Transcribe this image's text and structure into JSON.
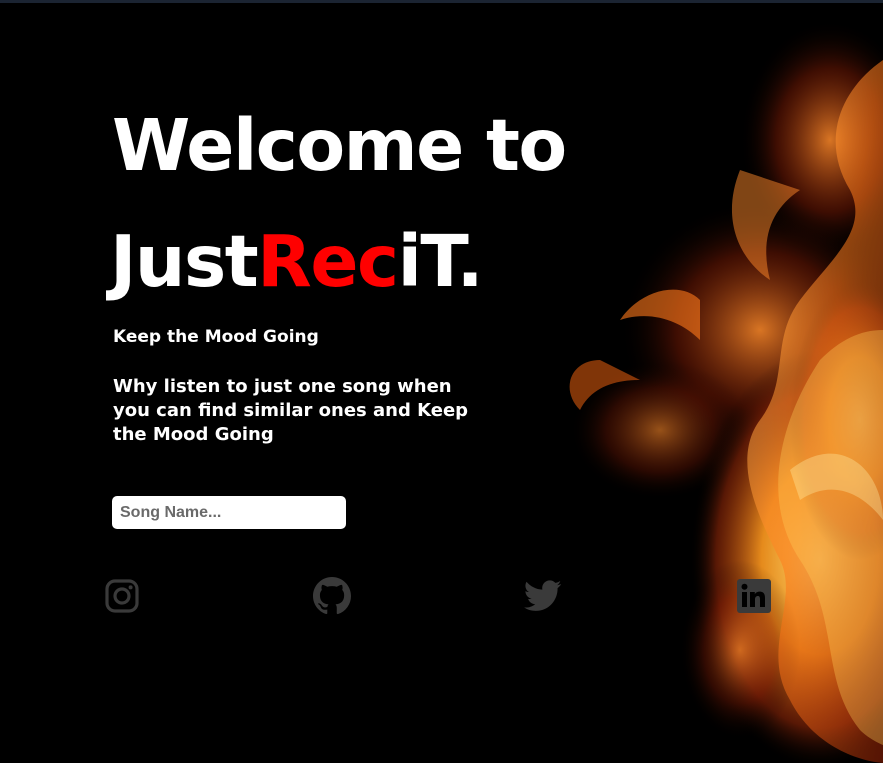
{
  "hero": {
    "title_line1": "Welcome to",
    "title_brand_part1": "Just",
    "title_brand_part2": "Rec",
    "title_brand_part3": "iT."
  },
  "tagline": "Keep the Mood Going",
  "description": "Why listen to just one song when you can find similar ones and Keep the Mood Going",
  "search": {
    "placeholder": "Song Name..."
  },
  "social": [
    "instagram-icon",
    "github-icon",
    "twitter-icon",
    "linkedin-icon"
  ],
  "colors": {
    "background": "#000000",
    "brand_accent": "#ff0000",
    "text": "#ffffff",
    "icon": "#3a3a3a"
  }
}
